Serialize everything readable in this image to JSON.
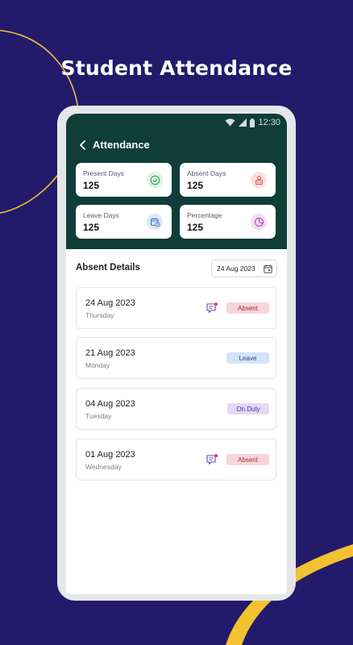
{
  "promo": {
    "title": "Student Attendance"
  },
  "status_bar": {
    "time": "12:30"
  },
  "app_bar": {
    "title": "Attendance"
  },
  "stats": [
    {
      "label": "Present Days",
      "value": "125",
      "icon": "check-circle-icon",
      "color": "#2e9d4f"
    },
    {
      "label": "Absent Days",
      "value": "125",
      "icon": "absent-user-icon",
      "color": "#d9534f"
    },
    {
      "label": "Leave Days",
      "value": "125",
      "icon": "calendar-clock-icon",
      "color": "#3b73c4"
    },
    {
      "label": "Percentage",
      "value": "125",
      "icon": "pie-chart-icon",
      "color": "#b03ab5"
    }
  ],
  "absent_details": {
    "title": "Absent Details",
    "date_filter": "24 Aug 2023",
    "records": [
      {
        "date": "24 Aug 2023",
        "day": "Thursday",
        "status": "Absent",
        "has_message": true
      },
      {
        "date": "21 Aug 2023",
        "day": "Monday",
        "status": "Leave",
        "has_message": false
      },
      {
        "date": "04 Aug 2023",
        "day": "Tuesday",
        "status": "On Duty",
        "has_message": false
      },
      {
        "date": "01 Aug 2023",
        "day": "Wednesday",
        "status": "Absent",
        "has_message": true
      }
    ]
  },
  "colors": {
    "background": "#241a6b",
    "header": "#0f3d38",
    "accent_curve": "#f2c230"
  }
}
